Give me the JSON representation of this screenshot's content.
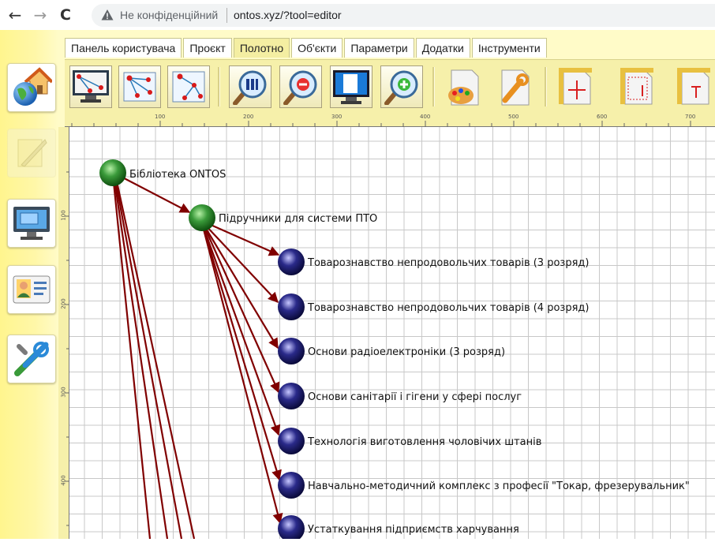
{
  "browser": {
    "security_label": "Не конфіденційний",
    "url": "ontos.xyz/?tool=editor",
    "back_glyph": "←",
    "forward_glyph": "→",
    "reload_glyph": "C"
  },
  "menu": {
    "tabs": [
      {
        "label": "Панель користувача"
      },
      {
        "label": "Проєкт"
      },
      {
        "label": "Полотно",
        "active": true
      },
      {
        "label": "Об'єкти"
      },
      {
        "label": "Параметри"
      },
      {
        "label": "Додатки"
      },
      {
        "label": "Інструменти"
      }
    ]
  },
  "sidebar": {
    "items": [
      {
        "icon": "home-globe-icon"
      },
      {
        "icon": "quill-icon",
        "disabled": true
      },
      {
        "icon": "monitor-icon"
      },
      {
        "icon": "user-card-icon"
      },
      {
        "icon": "tools-icon"
      }
    ]
  },
  "toolbar": {
    "icons": [
      "graph-monitor-icon",
      "graph-edit-icon",
      "graph-tree-icon",
      "zoom-fit-icon",
      "zoom-out-icon",
      "page-monitor-icon",
      "zoom-in-icon",
      "palette-icon",
      "wrench-icon",
      "page-width-icon",
      "page-height-icon",
      "page-size-icon"
    ]
  },
  "ruler": {
    "labels": [
      "100",
      "200",
      "300",
      "400",
      "500",
      "600",
      "700"
    ],
    "v_labels": [
      "100",
      "200",
      "300",
      "400"
    ]
  },
  "colors": {
    "edge": "#800000",
    "root_node": "#2e8b2e",
    "child_node": "#1c1c6e"
  },
  "graph": {
    "root": {
      "label": "Бібліотека ONTOS"
    },
    "hub": {
      "label": "Підручники для системи ПТО"
    },
    "children": [
      {
        "label": "Товарознавство непродовольчих товарів (3 розряд)"
      },
      {
        "label": "Товарознавство непродовольчих товарів (4 розряд)"
      },
      {
        "label": "Основи радіоелектроніки (3 розряд)"
      },
      {
        "label": "Основи санітарії і гігени у сфері послуг"
      },
      {
        "label": "Технологія виготовлення чоловічих штанів"
      },
      {
        "label": "Навчально-методичний комплекс з професії \"Токар, фрезерувальник\""
      },
      {
        "label": "Устаткування підприємств харчування"
      }
    ]
  }
}
